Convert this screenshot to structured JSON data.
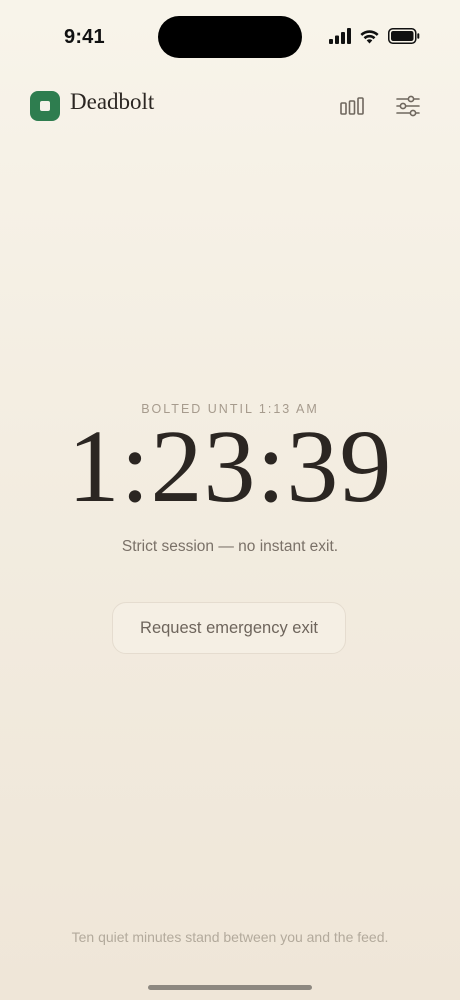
{
  "status_bar": {
    "time": "9:41"
  },
  "header": {
    "app_name": "Deadbolt",
    "brand_color": "#2e7d4f",
    "stats_icon": "bar-chart-icon",
    "settings_icon": "sliders-icon"
  },
  "session": {
    "until_label": "BOLTED UNTIL 1:13 AM",
    "countdown": "1:23:39",
    "note": "Strict session — no instant exit.",
    "exit_button_label": "Request emergency exit"
  },
  "footer": {
    "note": "Ten quiet minutes stand between you and the feed."
  }
}
